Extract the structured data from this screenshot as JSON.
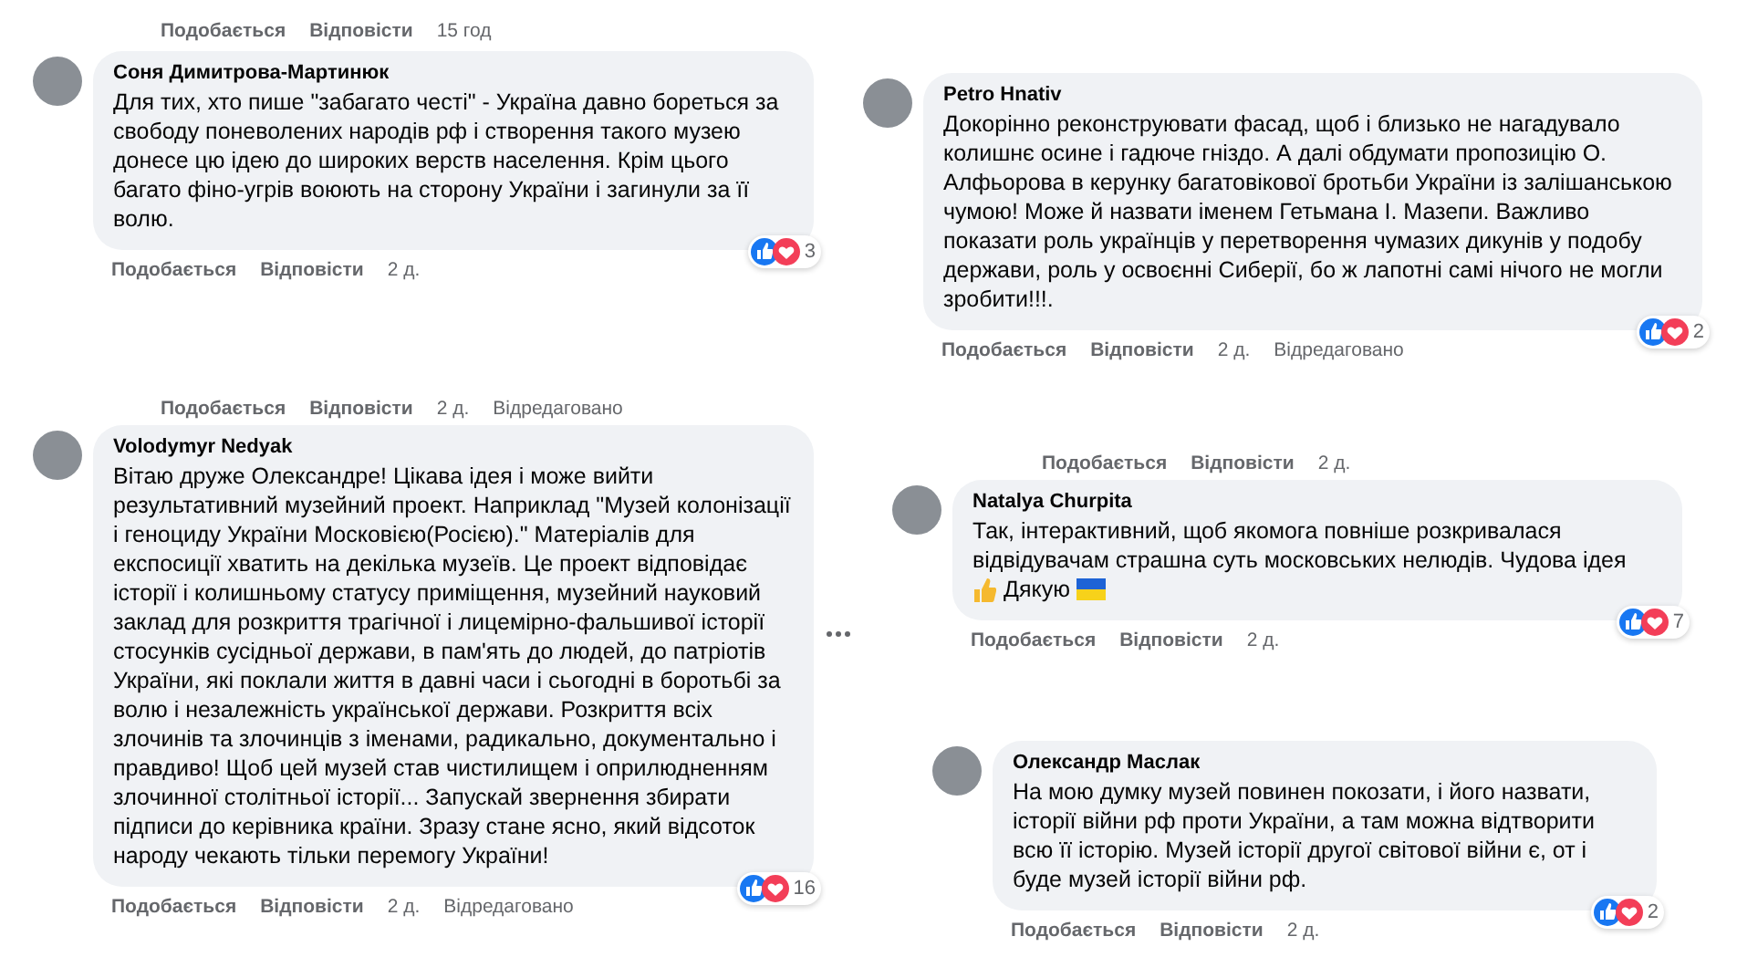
{
  "left": [
    {
      "kind": "actions",
      "actions": [
        "Подобається",
        "Відповісти",
        "15 год"
      ]
    },
    {
      "kind": "comment",
      "author": "Соня Димитрова-Мартинюк",
      "text": "Для тих, хто пише \"забагато честі\" - Україна давно бореться за свободу поневолених народів рф і створення такого музею донесе цю ідею до широких верств населення. Крім цього багато фіно-угрів воюють на сторону України і загинули за її волю.",
      "reaction_count": "3",
      "actions": [
        "Подобається",
        "Відповісти",
        "2 д."
      ]
    },
    {
      "kind": "actions",
      "actions": [
        "Подобається",
        "Відповісти",
        "2 д.",
        "Відредаговано"
      ]
    },
    {
      "kind": "comment",
      "author": "Volodymyr Nedyak",
      "text": "Вітаю друже Олександре! Цікава ідея і може вийти результативний музейний проект. Наприклад \"Музей колонізації і геноциду України Московією(Росією).\" Матеріалів для експосиції хватить на декілька музеїв. Це проект відповідає історії і колишньому статусу приміщення, музейний науковий заклад для розкриття трагічної і лицемірно-фальшивої історії стосунків сусідньої держави, в пам'ять до людей, до патріотів України, які поклали життя в давні часи і сьогодні в боротьбі за волю і незалежність української держави. Розкриття всіх злочинів та злочинців з іменами, радикально, документально і правдиво! Щоб цей музей став чистилищем і оприлюдненням злочинної столітньої історії... Запускай звернення збирати підписи до керівника країни. Зразу стане ясно, який відсоток народу чекають тільки перемогу України!",
      "reaction_count": "16",
      "actions": [
        "Подобається",
        "Відповісти",
        "2 д.",
        "Відредаговано"
      ]
    }
  ],
  "right": [
    {
      "kind": "comment",
      "author": "Petro Hnativ",
      "text": "Докорінно реконструювати фасад, щоб і близько не нагадувало колишнє осине і гадюче гніздо. А далі обдумати пропозицію О. Алфьорова в керунку багатовікової бротьби України із залішанською чумою! Може й назвати іменем Гетьмана І. Мазепи. Важливо показати роль українців у перетворення чумазих дикунів у подобу держави, роль у освоєнні Сиберії, бо ж лапотні самі нічого не могли зробити!!!.",
      "reaction_count": "2",
      "actions": [
        "Подобається",
        "Відповісти",
        "2 д.",
        "Відредаговано"
      ]
    },
    {
      "kind": "actions",
      "actions": [
        "Подобається",
        "Відповісти",
        "2 д."
      ]
    },
    {
      "kind": "comment",
      "author": "Natalya Churpita",
      "text": "Так, інтерактивний, щоб якомога повніше розкривалася відвідувачам страшна суть московських нелюдів. Чудова ідея",
      "emoji_line": "Дякую",
      "reaction_count": "7",
      "actions": [
        "Подобається",
        "Відповісти",
        "2 д."
      ]
    },
    {
      "kind": "comment",
      "author": "Олександр Маслак",
      "text": "На мою думку музей повинен покозати, і його назвати, історії війни рф проти України, а там можна відтворити всю її історію. Музей історії другої світової війни є, от і буде музей історії війни рф.",
      "reaction_count": "2",
      "actions": [
        "Подобається",
        "Відповісти",
        "2 д."
      ]
    }
  ]
}
